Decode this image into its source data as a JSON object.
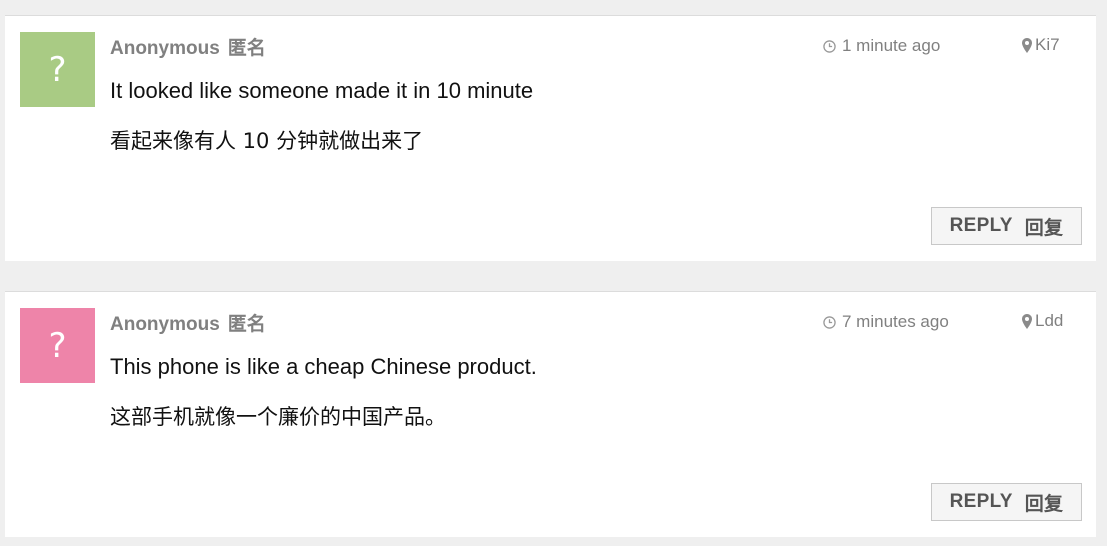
{
  "comments": [
    {
      "avatar_glyph": "?",
      "avatar_color": "#a9cb84",
      "author_en": "Anonymous",
      "author_cn": "匿名",
      "time": "1 minute ago",
      "location": "Ki7",
      "text_en": "It looked like someone made it in 10 minute",
      "text_cn": "看起来像有人 10 分钟就做出来了",
      "reply_en": "REPLY",
      "reply_cn": "回复"
    },
    {
      "avatar_glyph": "?",
      "avatar_color": "#ee84a9",
      "author_en": "Anonymous",
      "author_cn": "匿名",
      "time": "7 minutes ago",
      "location": "Ldd",
      "text_en": "This phone is like a cheap Chinese product.",
      "text_cn": "这部手机就像一个廉价的中国产品。",
      "reply_en": "REPLY",
      "reply_cn": "回复"
    }
  ],
  "icons": {
    "time": "clock-icon",
    "location": "map-pin-icon"
  }
}
